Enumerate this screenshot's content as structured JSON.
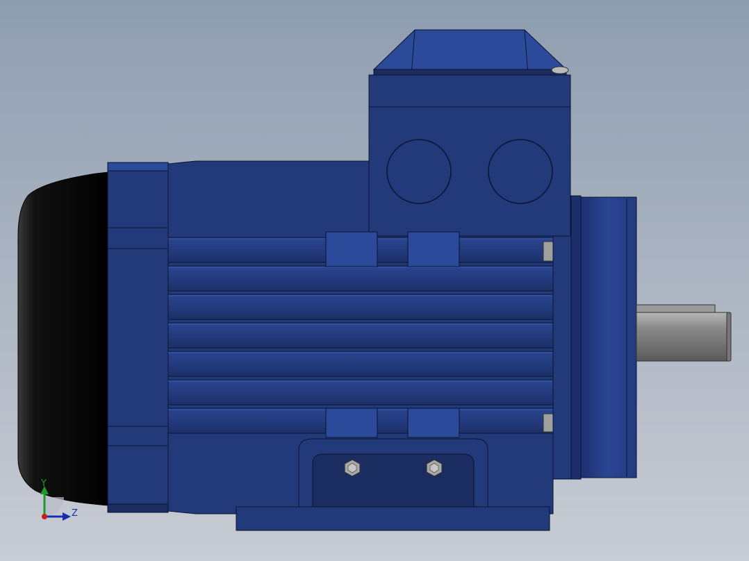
{
  "viewport": {
    "background_top": "#8e9db0",
    "background_bottom": "#c8ccd4"
  },
  "model": {
    "body_color": "#22397a",
    "body_dark": "#1a2c60",
    "body_light": "#2c4a9a",
    "edge_color": "#0b1430",
    "fan_cover_color": "#050505",
    "shaft_color": "#8a8a8a",
    "bolt_color": "#9a9a9a"
  },
  "triad": {
    "y_label": "Y",
    "z_label": "Z",
    "y_color": "#1f9a2a",
    "z_color": "#1a2fb0",
    "origin_color": "#c81d1d"
  }
}
